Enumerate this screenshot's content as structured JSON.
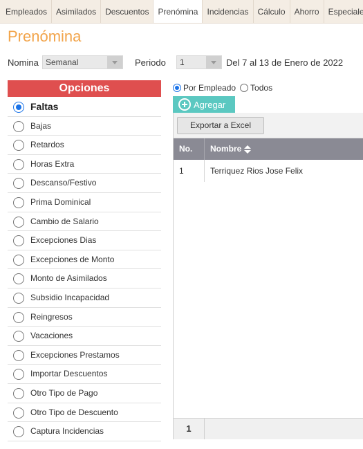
{
  "tabs": [
    "Empleados",
    "Asimilados",
    "Descuentos",
    "Prenómina",
    "Incidencias",
    "Cálculo",
    "Ahorro",
    "Especiales"
  ],
  "active_tab": "Prenómina",
  "page_title": "Prenómina",
  "filters": {
    "nomina_label": "Nomina",
    "nomina_value": "Semanal",
    "periodo_label": "Periodo",
    "periodo_value": "1",
    "period_range": "Del 7 al 13 de Enero de 2022"
  },
  "options": {
    "header": "Opciones",
    "selected": "Faltas",
    "items": [
      "Faltas",
      "Bajas",
      "Retardos",
      "Horas Extra",
      "Descanso/Festivo",
      "Prima Dominical",
      "Cambio de Salario",
      "Excepciones Dias",
      "Excepciones de Monto",
      "Monto de Asimilados",
      "Subsidio Incapacidad",
      "Reingresos",
      "Vacaciones",
      "Excepciones Prestamos",
      "Importar Descuentos",
      "Otro Tipo de Pago",
      "Otro Tipo de Descuento",
      "Captura Incidencias"
    ]
  },
  "mode": {
    "por_empleado": "Por Empleado",
    "todos": "Todos",
    "selected": "Por Empleado"
  },
  "add_button": "Agregar",
  "grid": {
    "export_button": "Exportar a Excel",
    "columns": [
      "No.",
      "Nombre"
    ],
    "rows": [
      {
        "no": "1",
        "nombre": "Terriquez Rios Jose Felix"
      }
    ],
    "current_page": "1"
  },
  "colors": {
    "accent_title": "#f2a44a",
    "options_header": "#df4f4f",
    "add_button": "#5bc8c1",
    "table_header": "#8a8a94",
    "radio_selected": "#1a73e8"
  }
}
